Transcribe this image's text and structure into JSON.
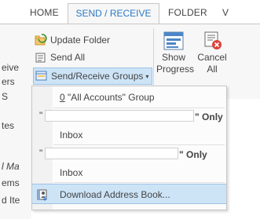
{
  "tabs": [
    {
      "label": "HOME"
    },
    {
      "label": "SEND / RECEIVE"
    },
    {
      "label": "FOLDER"
    },
    {
      "label": "V"
    }
  ],
  "ribbon": {
    "update_folder": "Update Folder",
    "send_all": "Send All",
    "send_receive_groups": "Send/Receive Groups",
    "show_progress_line1": "Show",
    "show_progress_line2": "Progress",
    "cancel_all_line1": "Cancel",
    "cancel_all_line2": "All"
  },
  "left_edge_fragments": [
    "eive",
    "ers",
    "S",
    "tes",
    "l Ma",
    "ems",
    "d Ite"
  ],
  "menu": {
    "items": [
      {
        "shortcut": "0",
        "label": "\"All Accounts\" Group"
      },
      {
        "quote_open": "\"",
        "suffix": "\" Only"
      },
      {
        "label": "Inbox"
      },
      {
        "quote_open": "\"",
        "suffix": "\" Only"
      },
      {
        "label": "Inbox"
      },
      {
        "label": "Download Address Book..."
      }
    ]
  }
}
